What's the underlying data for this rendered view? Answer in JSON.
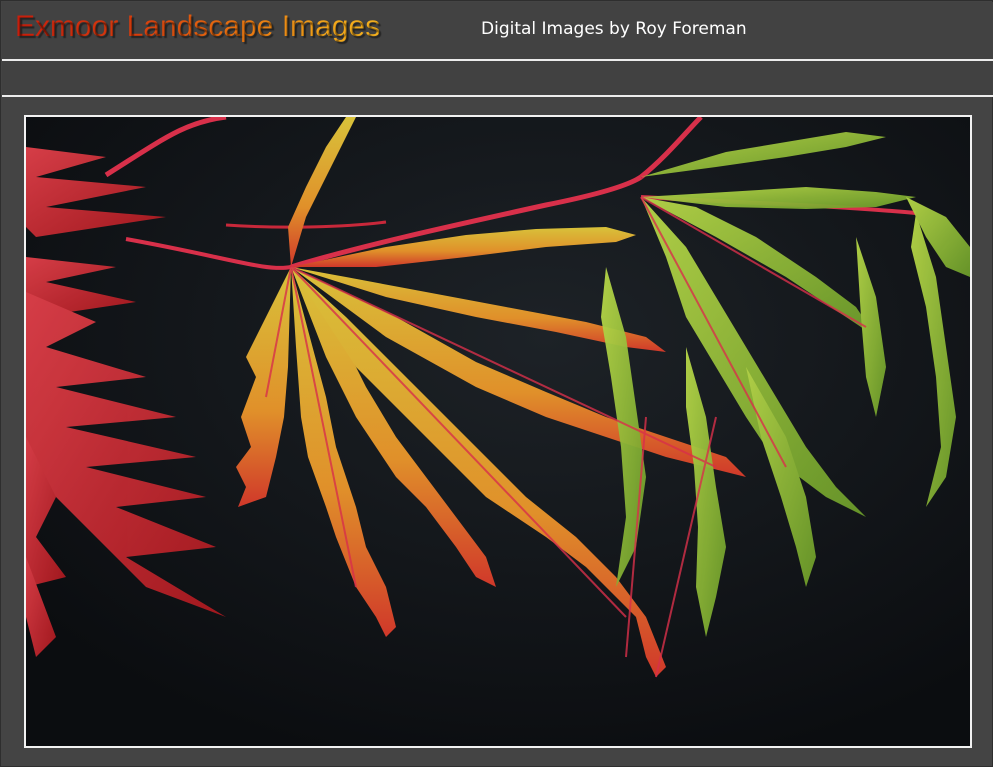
{
  "header": {
    "title": "Exmoor Landscape Images",
    "subtitle": "Digital Images by Roy Foreman"
  },
  "photo": {
    "subject": "maple-leaves-icon",
    "colors": {
      "background": "#0f1216",
      "leaf_red": "#c8283a",
      "leaf_orange": "#e07a2a",
      "leaf_yellow": "#d8c23a",
      "leaf_green": "#9cc23a",
      "stem": "#d8304a"
    }
  }
}
